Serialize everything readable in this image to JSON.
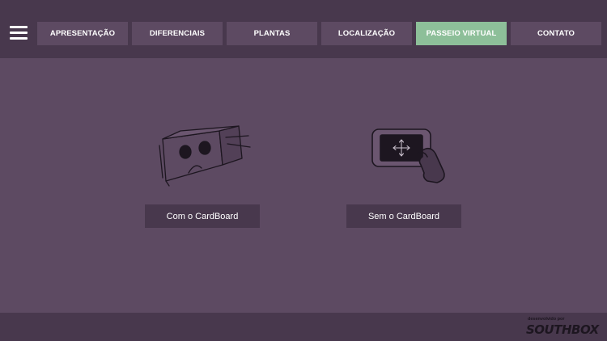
{
  "nav": {
    "items": [
      {
        "label": "APRESENTAÇÃO"
      },
      {
        "label": "DIFERENCIAIS"
      },
      {
        "label": "PLANTAS"
      },
      {
        "label": "LOCALIZAÇÃO"
      },
      {
        "label": "PASSEIO VIRTUAL",
        "active": true
      },
      {
        "label": "CONTATO"
      }
    ]
  },
  "options": {
    "cardboard": {
      "label": "Com o CardBoard",
      "icon": "vr-headset-icon"
    },
    "no_cardboard": {
      "label": "Sem o CardBoard",
      "icon": "hand-phone-icon"
    }
  },
  "footer": {
    "credit_small": "desenvolvido por",
    "credit_logo": "SOUTHBOX"
  },
  "colors": {
    "background": "#5d4a62",
    "bar": "#48384d",
    "active": "#8dbf99"
  }
}
